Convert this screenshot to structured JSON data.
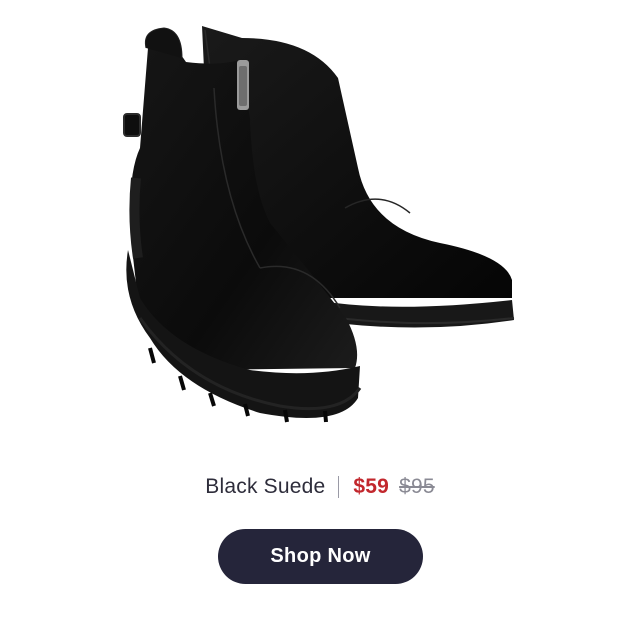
{
  "product": {
    "image_alt": "Pair of black suede ankle boots",
    "color_name": "Black Suede",
    "separator": "|",
    "sale_price": "$59",
    "original_price": "$95"
  },
  "cta": {
    "label": "Shop Now"
  },
  "colors": {
    "button_background": "#25253a",
    "sale_price": "#c2272d",
    "original_price": "#8a8a94",
    "text": "#2e2d3b"
  }
}
